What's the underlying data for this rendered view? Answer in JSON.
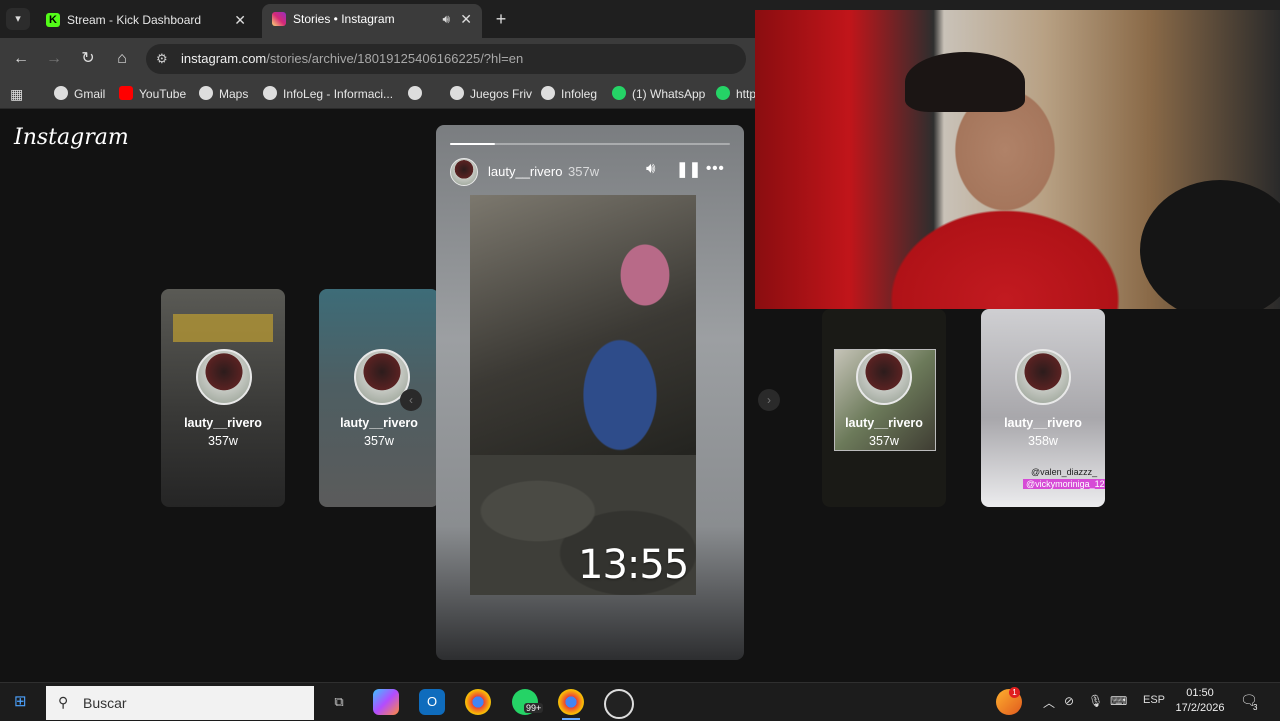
{
  "browser": {
    "tabs": [
      {
        "title": "Stream - Kick Dashboard",
        "favicon": "kick-icon",
        "favicon_text": "K"
      },
      {
        "title": "Stories • Instagram",
        "favicon": "instagram-icon"
      }
    ],
    "url_host": "instagram.com",
    "url_path": "/stories/archive/18019125406166225/?hl=en",
    "bookmarks": [
      "Gmail",
      "YouTube",
      "Maps",
      "InfoLeg - Informaci...",
      "",
      "Juegos Friv",
      "Infoleg",
      "(1) WhatsApp",
      "http"
    ]
  },
  "instagram": {
    "logo": "Instagram",
    "active_story": {
      "username": "lauty__rivero",
      "age": "357w",
      "progress": 0.16,
      "overlay_time": "13:55"
    },
    "cards": [
      {
        "username": "lauty__rivero",
        "age": "357w"
      },
      {
        "username": "lauty__rivero",
        "age": "357w"
      },
      {
        "username": "lauty__rivero",
        "age": "357w"
      },
      {
        "username": "lauty__rivero",
        "age": "358w",
        "tags": [
          "@valen_diazzz_",
          "@vickymoriniga_12"
        ]
      }
    ]
  },
  "taskbar": {
    "search_placeholder": "Buscar",
    "whatsapp_badge": "99+",
    "notification_badge": "1",
    "language": "ESP",
    "time": "01:50",
    "date": "17/2/2026",
    "chat_count": "3"
  },
  "colors": {
    "accent": "#66aaff",
    "instagram_gradient_start": "#feda75",
    "instagram_gradient_end": "#962fbf",
    "kick_green": "#53fc18"
  }
}
